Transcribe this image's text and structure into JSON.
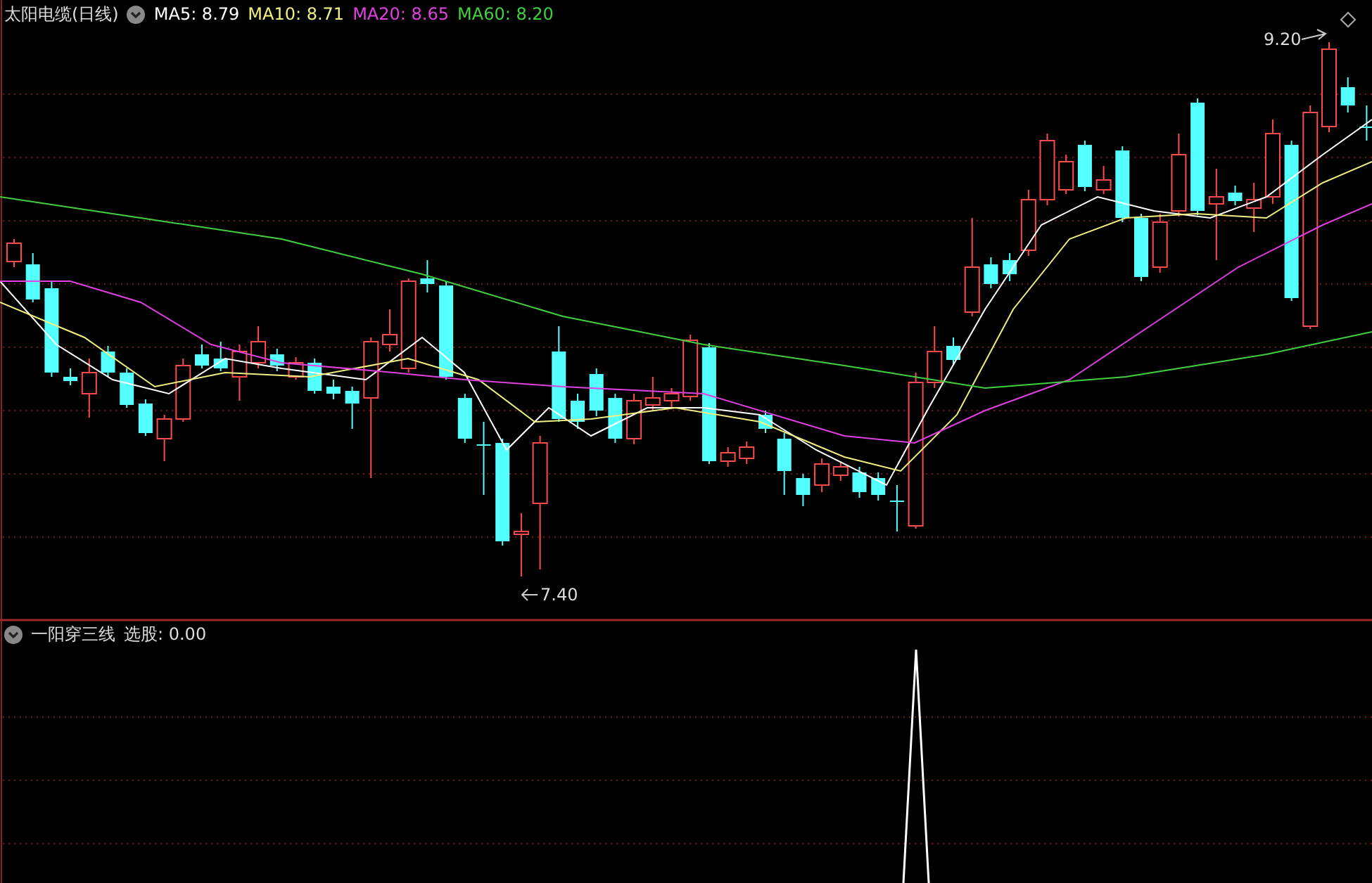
{
  "main_chart": {
    "title": "太阳电缆(日线)",
    "indicators": [
      {
        "label": "MA5: 8.79",
        "color": "#ffffff"
      },
      {
        "label": "MA10: 8.71",
        "color": "#f0f080"
      },
      {
        "label": "MA20: 8.65",
        "color": "#e040e0"
      },
      {
        "label": "MA60: 8.20",
        "color": "#40d040"
      }
    ],
    "high_label": "9.20",
    "low_label": "7.40"
  },
  "indicator_pane": {
    "title": "一阳穿三线",
    "reading": "选股: 0.00"
  }
}
